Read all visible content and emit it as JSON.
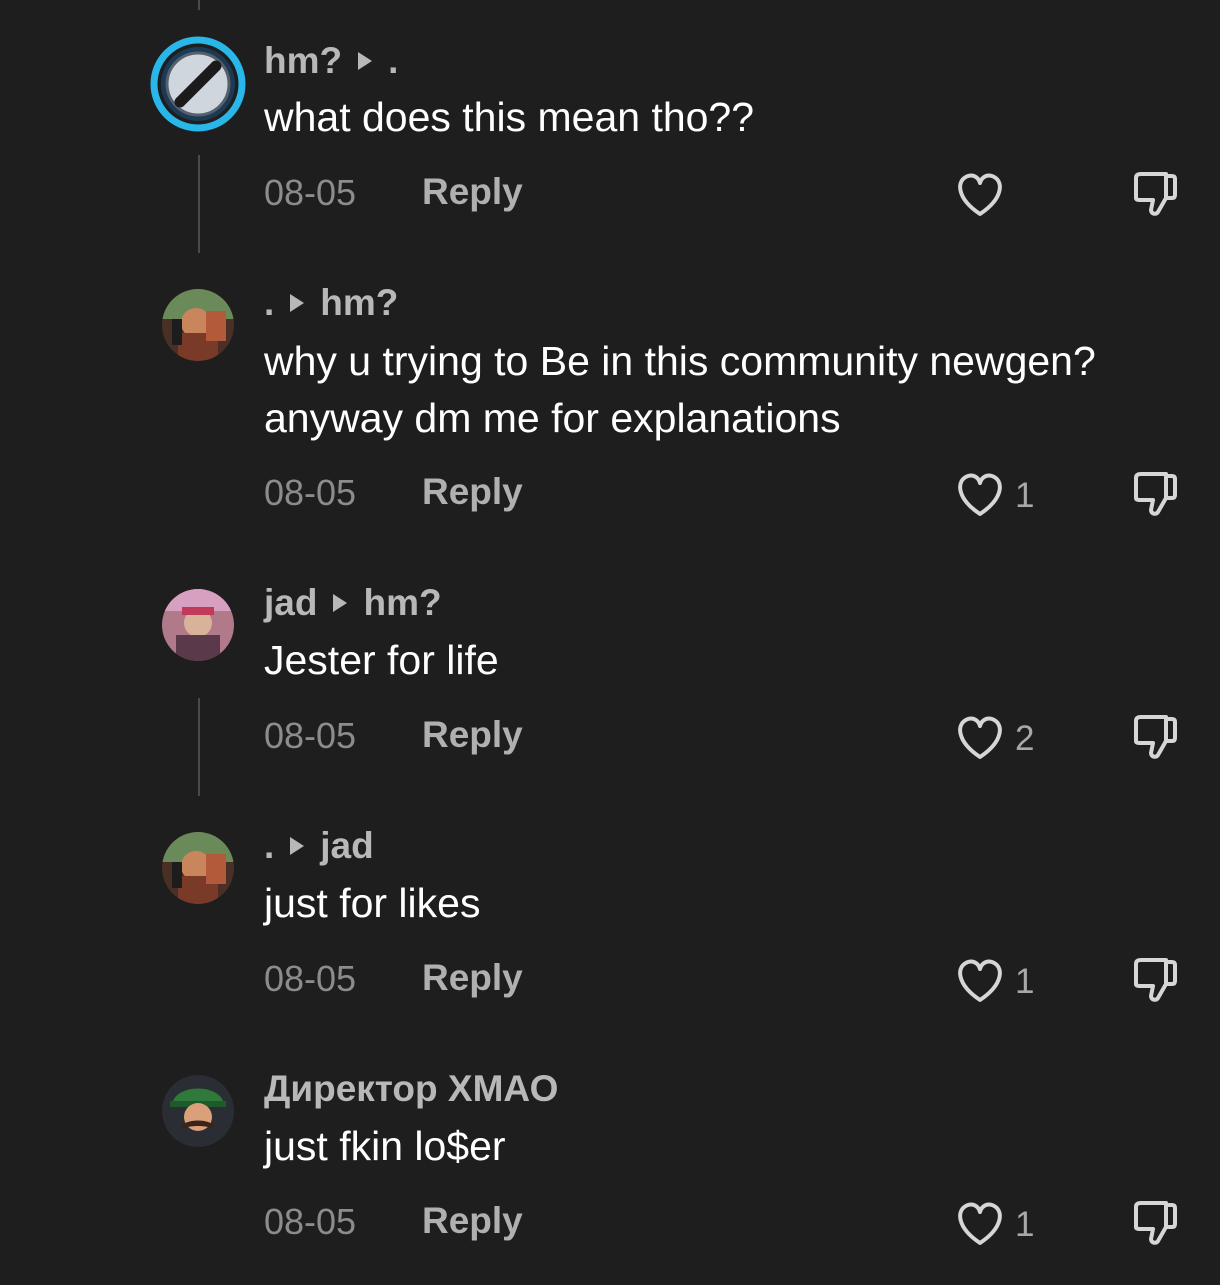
{
  "comments": [
    {
      "author": "hm?",
      "reply_to": ".",
      "text": "what does this mean tho??",
      "date": "08-05",
      "reply_label": "Reply",
      "likes": ""
    },
    {
      "author": ".",
      "reply_to": "hm?",
      "text": "why u trying to Be in this community newgen? anyway dm me for explanations",
      "date": "08-05",
      "reply_label": "Reply",
      "likes": "1"
    },
    {
      "author": "jad",
      "reply_to": "hm?",
      "text": "Jester for life",
      "date": "08-05",
      "reply_label": "Reply",
      "likes": "2"
    },
    {
      "author": ".",
      "reply_to": "jad",
      "text": "just for likes",
      "date": "08-05",
      "reply_label": "Reply",
      "likes": "1"
    },
    {
      "author": "Директор ХМАО",
      "text": "just fkin lo$er",
      "date": "08-05",
      "reply_label": "Reply",
      "likes": "1"
    }
  ],
  "icons": {
    "reply_arrow": "right-triangle-icon",
    "like": "heart-outline-icon",
    "dislike": "thumbs-down-outline-icon"
  },
  "colors": {
    "background": "#1e1e1e",
    "avatar_ring": "#29b6e8",
    "username": "#b8b8b8",
    "meta": "#8c8c8c"
  }
}
